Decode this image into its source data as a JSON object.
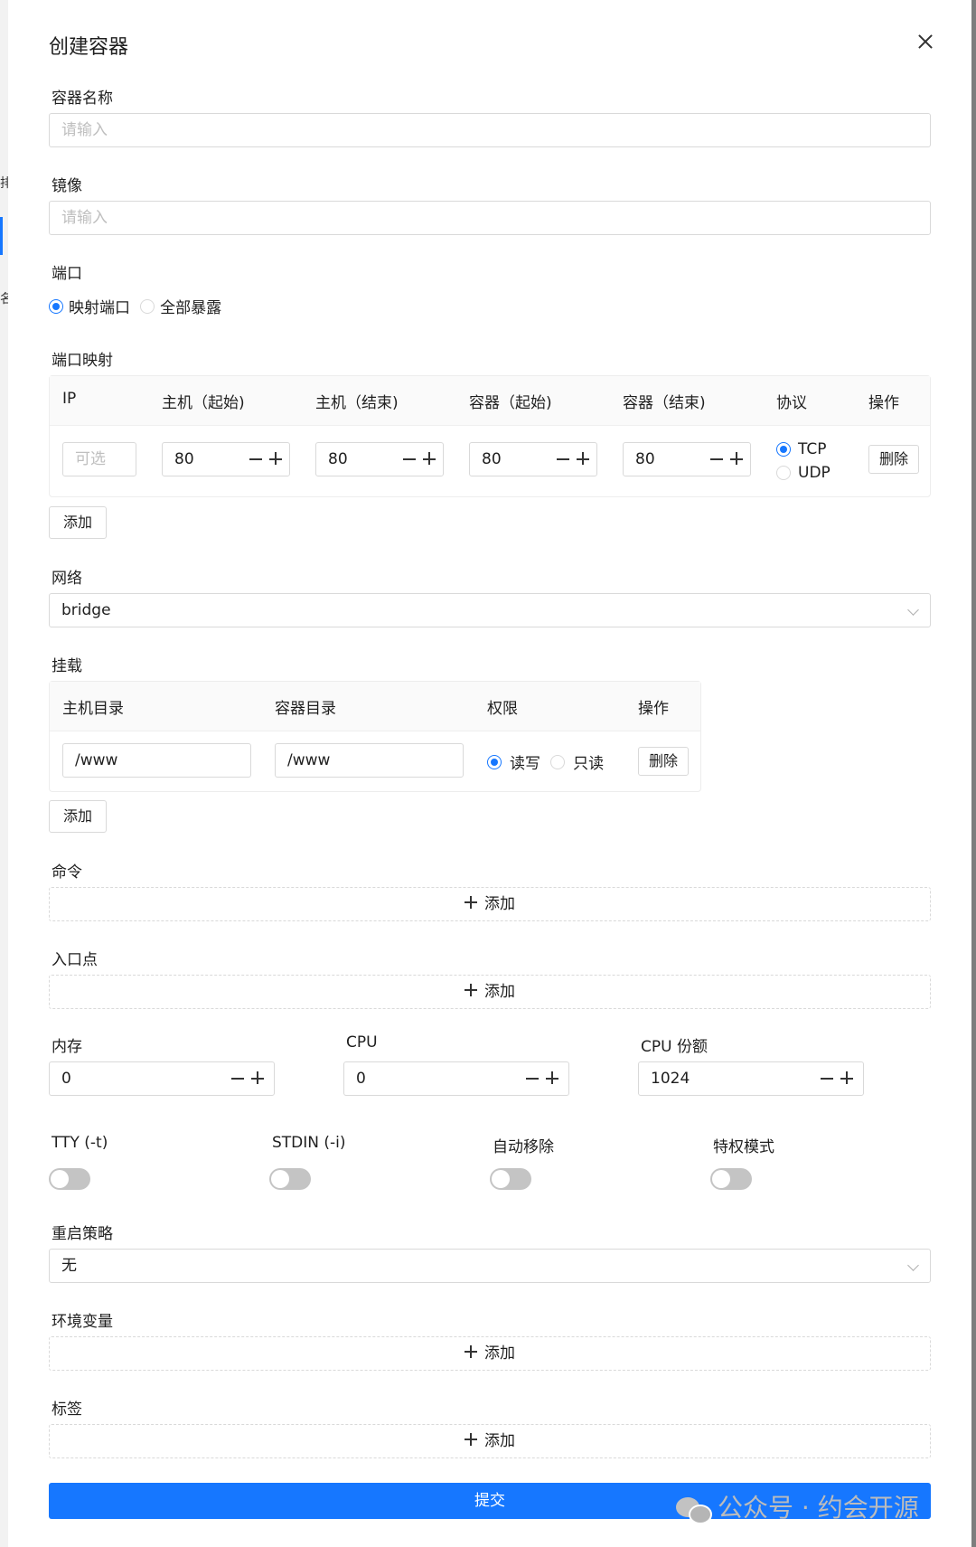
{
  "sidebar_fragments": [
    "排",
    "名"
  ],
  "dialog": {
    "title": "创建容器"
  },
  "name": {
    "label": "容器名称",
    "placeholder": "请输入"
  },
  "image": {
    "label": "镜像",
    "placeholder": "请输入"
  },
  "port": {
    "label": "端口",
    "options": [
      {
        "label": "映射端口",
        "selected": true
      },
      {
        "label": "全部暴露",
        "selected": false
      }
    ]
  },
  "port_mapping": {
    "label": "端口映射",
    "headers": [
      "IP",
      "主机（起始)",
      "主机（结束)",
      "容器（起始)",
      "容器（结束)",
      "协议",
      "操作"
    ],
    "rows": [
      {
        "ip_placeholder": "可选",
        "host_start": "80",
        "host_end": "80",
        "container_start": "80",
        "container_end": "80",
        "protocols": [
          {
            "label": "TCP",
            "selected": true
          },
          {
            "label": "UDP",
            "selected": false
          }
        ],
        "delete_label": "删除"
      }
    ],
    "add_label": "添加"
  },
  "network": {
    "label": "网络",
    "value": "bridge"
  },
  "mount": {
    "label": "挂载",
    "headers": [
      "主机目录",
      "容器目录",
      "权限",
      "操作"
    ],
    "rows": [
      {
        "host_dir": "/www",
        "container_dir": "/www",
        "perms": [
          {
            "label": "读写",
            "selected": true
          },
          {
            "label": "只读",
            "selected": false
          }
        ],
        "delete_label": "删除"
      }
    ],
    "add_label": "添加"
  },
  "command": {
    "label": "命令",
    "add_label": "添加"
  },
  "entrypoint": {
    "label": "入口点",
    "add_label": "添加"
  },
  "resources": {
    "memory": {
      "label": "内存",
      "value": "0"
    },
    "cpu": {
      "label": "CPU",
      "value": "0"
    },
    "cpu_shares": {
      "label": "CPU 份额",
      "value": "1024"
    }
  },
  "toggles": [
    {
      "label": "TTY (-t)",
      "on": false
    },
    {
      "label": "STDIN (-i)",
      "on": false
    },
    {
      "label": "自动移除",
      "on": false
    },
    {
      "label": "特权模式",
      "on": false
    }
  ],
  "restart_policy": {
    "label": "重启策略",
    "value": "无"
  },
  "env": {
    "label": "环境变量",
    "add_label": "添加"
  },
  "labels": {
    "label": "标签",
    "add_label": "添加"
  },
  "submit_label": "提交",
  "watermark": {
    "text": "公众号 · 约会开源",
    "icon": "wechat-icon"
  },
  "colors": {
    "primary": "#1677ff",
    "border": "#d9d9d9",
    "toggle_off": "#c4c4c4"
  }
}
